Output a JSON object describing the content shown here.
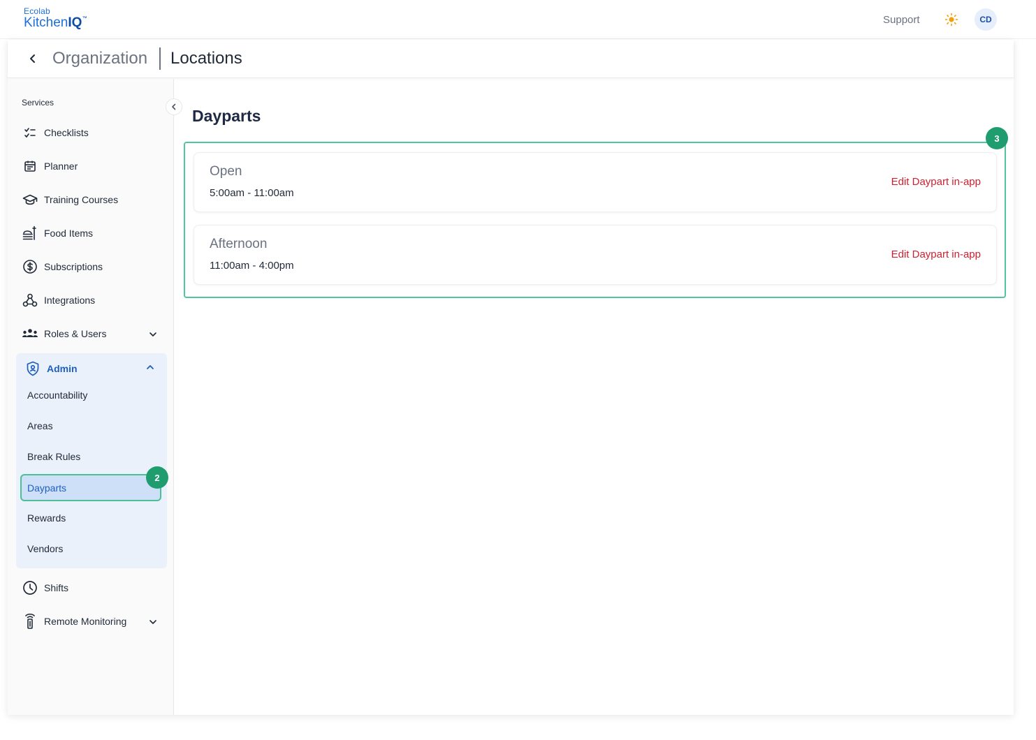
{
  "brand": {
    "line1": "Ecolab",
    "line2_regular": "Kitchen",
    "line2_bold": "IQ",
    "tm": "™"
  },
  "topbar": {
    "support_label": "Support",
    "avatar_initials": "CD"
  },
  "breadcrumb": {
    "parent": "Organization",
    "current": "Locations"
  },
  "sidebar": {
    "section_label": "Services",
    "items": [
      {
        "label": "Checklists",
        "icon": "checklist-icon"
      },
      {
        "label": "Planner",
        "icon": "calendar-icon"
      },
      {
        "label": "Training Courses",
        "icon": "graduation-cap-icon"
      },
      {
        "label": "Food Items",
        "icon": "food-tray-icon"
      },
      {
        "label": "Subscriptions",
        "icon": "dollar-circle-icon"
      },
      {
        "label": "Integrations",
        "icon": "webhook-icon"
      },
      {
        "label": "Roles & Users",
        "icon": "users-icon"
      }
    ],
    "admin": {
      "label": "Admin",
      "sub_items": [
        "Accountability",
        "Areas",
        "Break Rules",
        "Dayparts",
        "Rewards",
        "Vendors"
      ],
      "active": "Dayparts"
    },
    "after": [
      {
        "label": "Shifts",
        "icon": "clock-icon"
      },
      {
        "label": "Remote Monitoring",
        "icon": "remote-icon"
      }
    ]
  },
  "badges": {
    "sidebar": "2",
    "content": "3"
  },
  "main": {
    "title": "Dayparts",
    "dayparts": [
      {
        "name": "Open",
        "time": "5:00am - 11:00am",
        "action": "Edit Daypart in-app"
      },
      {
        "name": "Afternoon",
        "time": "11:00am - 4:00pm",
        "action": "Edit Daypart in-app"
      }
    ]
  },
  "colors": {
    "brand_blue": "#1e6fd9",
    "active_blue": "#1d5fbf",
    "highlight_green": "#55c49c",
    "badge_green": "#1f9d6e",
    "edit_red": "#d0202f"
  }
}
